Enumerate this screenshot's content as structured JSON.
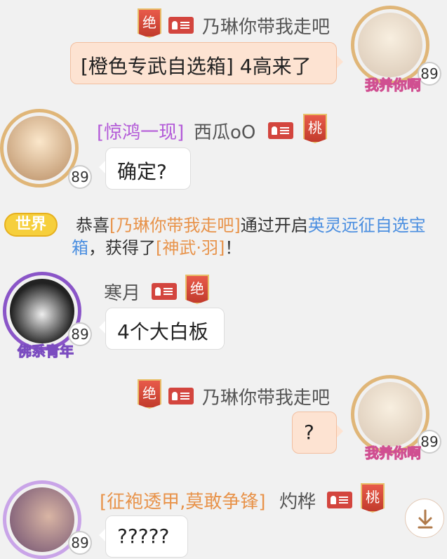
{
  "messages": [
    {
      "sender": "乃琳你带我走吧",
      "prefix": "",
      "badge": "绝",
      "text": "[橙色专武自选箱] 4高来了",
      "level": "89",
      "caption": "我养你啊"
    },
    {
      "sender": "西瓜oO",
      "prefix": "[惊鸿一现]",
      "badge": "桃",
      "text": "确定?",
      "level": "89"
    },
    {
      "sender": "寒月",
      "prefix": "",
      "badge": "绝",
      "text": "4个大白板",
      "level": "89",
      "caption": "佛系青年"
    },
    {
      "sender": "乃琳你带我走吧",
      "prefix": "",
      "badge": "绝",
      "text": "?",
      "level": "89",
      "caption": "我养你啊"
    },
    {
      "sender": "灼桦",
      "prefix": "[征袍透甲,莫敢争锋]",
      "badge": "桃",
      "text": "?????",
      "level": "89"
    }
  ],
  "system_notice": {
    "tag": "世界",
    "part1": "恭喜",
    "player": "[乃琳你带我走吧]",
    "part2": "通过开启",
    "box": "英灵远征自选宝箱",
    "part3": "，获得了",
    "item": "[神武·羽]",
    "part4": "！"
  },
  "colors": {
    "accent": "#e8934a",
    "blue": "#4a8ee0",
    "purple": "#b35ad8",
    "gold": "#f6cf3c"
  },
  "icons": {
    "scroll": "arrow-down-icon",
    "id": "id-card-icon"
  }
}
